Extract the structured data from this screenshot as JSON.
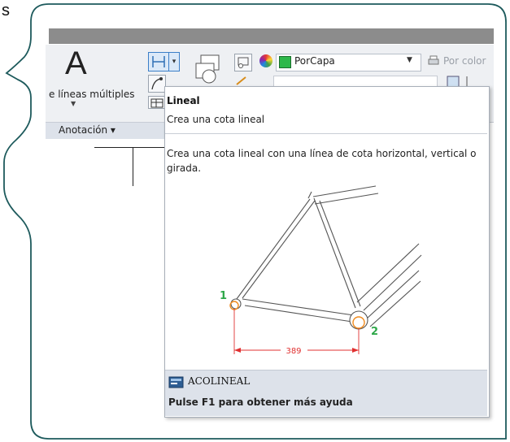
{
  "slide_title": "s",
  "ribbon": {
    "mtext_label": "e líneas múltiples",
    "panel_label": "Anotación ▾",
    "color_value": "PorCapa",
    "plot_style": "Por color"
  },
  "tooltip": {
    "title": "Lineal",
    "subtitle": "Crea una cota lineal",
    "description": "Crea una cota lineal con una línea de cota horizontal, vertical o girada.",
    "illustration": {
      "point1_label": "1",
      "point2_label": "2",
      "dimension_value": "389"
    },
    "command_name": "ACOLINEAL",
    "help_text": "Pulse F1 para obtener más ayuda"
  },
  "colors": {
    "accent_green": "#2fa84a",
    "dimension_red": "#e03030",
    "frame_teal": "#1d5a5c"
  }
}
